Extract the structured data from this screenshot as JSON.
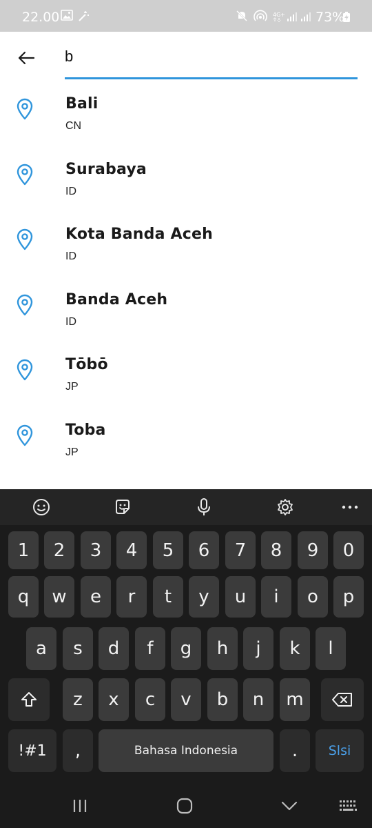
{
  "status_bar": {
    "time": "22.00",
    "battery": "73%",
    "icons": [
      "gallery-icon",
      "wand-icon",
      "mute-icon",
      "hotspot-icon",
      "4g-icon",
      "signal-icon",
      "signal-icon",
      "battery-charging-icon"
    ]
  },
  "search": {
    "value": "b",
    "accent_color": "#2f95dc"
  },
  "results": [
    {
      "name": "Bali",
      "country": "CN"
    },
    {
      "name": "Surabaya",
      "country": "ID"
    },
    {
      "name": "Kota Banda Aceh",
      "country": "ID"
    },
    {
      "name": "Banda Aceh",
      "country": "ID"
    },
    {
      "name": "Tōbō",
      "country": "JP"
    },
    {
      "name": "Toba",
      "country": "JP"
    }
  ],
  "keyboard": {
    "toolbar": [
      "emoji-icon",
      "sticker-icon",
      "microphone-icon",
      "settings-icon",
      "more-icon"
    ],
    "row_numbers": [
      "1",
      "2",
      "3",
      "4",
      "5",
      "6",
      "7",
      "8",
      "9",
      "0"
    ],
    "row_1": [
      "q",
      "w",
      "e",
      "r",
      "t",
      "y",
      "u",
      "i",
      "o",
      "p"
    ],
    "row_2": [
      "a",
      "s",
      "d",
      "f",
      "g",
      "h",
      "j",
      "k",
      "l"
    ],
    "row_3": [
      "z",
      "x",
      "c",
      "v",
      "b",
      "n",
      "m"
    ],
    "symbols_label": "!#1",
    "comma_label": ",",
    "space_label": "Bahasa Indonesia",
    "period_label": ".",
    "action_label": "Slsi",
    "action_color": "#4a9fe8"
  },
  "nav_bar": [
    "recents-icon",
    "home-icon",
    "back-chevron-icon",
    "keyboard-icon"
  ]
}
